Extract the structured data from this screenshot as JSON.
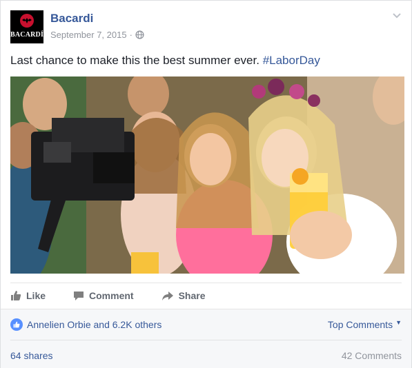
{
  "post": {
    "page_name": "Bacardi",
    "logo_text": "BACARDÍ",
    "date": "September 7, 2015",
    "separator": "·",
    "privacy_icon": "globe-icon",
    "message": "Last chance to make this the best summer ever.",
    "hashtag": "#LaborDay",
    "options_icon": "chevron-down-icon"
  },
  "actions": {
    "like_label": "Like",
    "comment_label": "Comment",
    "share_label": "Share"
  },
  "engagement": {
    "likers_text": "Annelien Orbie and 6.2K others",
    "top_comments_label": "Top Comments",
    "shares_text": "64 shares",
    "comments_text": "42 Comments"
  },
  "colors": {
    "link": "#365899",
    "muted": "#90949c",
    "like_blue": "#5890ff",
    "logo_red": "#c8102e"
  }
}
